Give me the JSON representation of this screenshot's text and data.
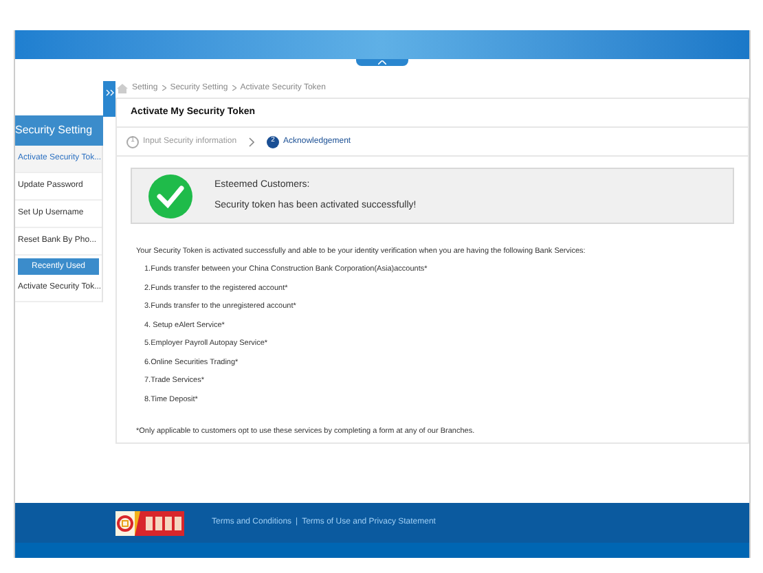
{
  "breadcrumb": [
    "Setting",
    "Security Setting",
    "Activate Security Token"
  ],
  "sidebar": {
    "title": "Security Setting",
    "items": [
      {
        "label": "Activate Security Tok...",
        "selected": true
      },
      {
        "label": "Update Password",
        "selected": false
      },
      {
        "label": "Set Up Username",
        "selected": false
      },
      {
        "label": "Reset Bank By Pho...",
        "selected": false
      }
    ],
    "recent_title": "Recently Used",
    "recent_items": [
      {
        "label": "Activate Security Tok...",
        "selected": false
      }
    ]
  },
  "card": {
    "title": "Activate My Security Token",
    "steps": [
      {
        "number": "1",
        "label": "Input Security information",
        "selected": false
      },
      {
        "number": "2",
        "label": "Acknowledgement",
        "selected": true
      }
    ],
    "success": {
      "greeting": "Esteemed Customers:",
      "message": "Security token has been activated successfully!"
    },
    "intro": "Your Security Token is activated successfully and able to be your identity verification when you are having the following Bank Services:",
    "services": [
      "1.Funds transfer between your China Construction Bank Corporation(Asia)accounts*",
      "2.Funds transfer to the registered account*",
      "3.Funds transfer to the unregistered account*",
      "4. Setup eAlert Service*",
      "5.Employer Payroll Autopay Service*",
      "6.Online Securities Trading*",
      "7.Trade Services*",
      "8.Time Deposit*"
    ],
    "footnote": "*Only applicable to customers opt to use these services by completing a form at any of our Branches."
  },
  "footer": {
    "links": [
      "Terms and Conditions",
      "Terms of Use and Privacy Statement"
    ],
    "separator": "|"
  }
}
